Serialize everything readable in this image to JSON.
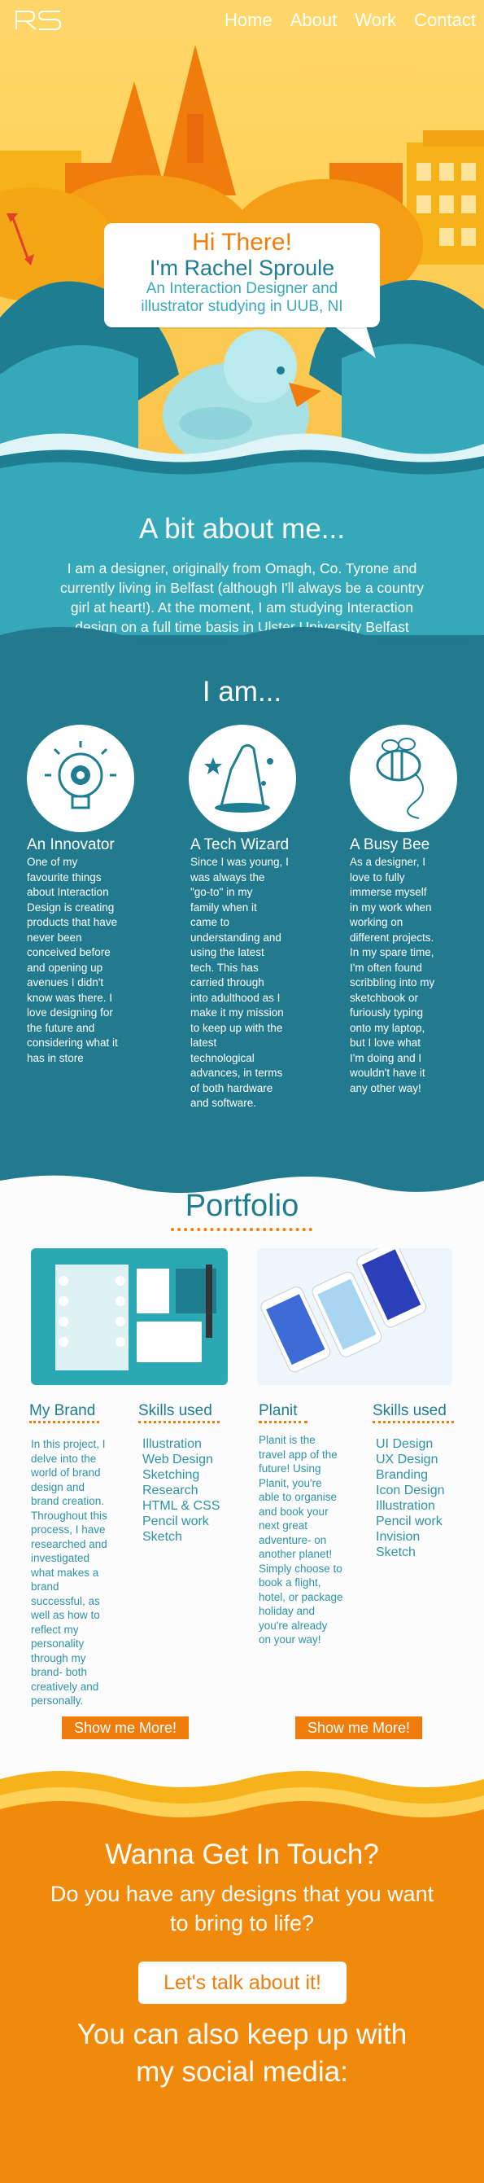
{
  "nav": {
    "logo": "RS",
    "links": [
      "Home",
      "About",
      "Work",
      "Contact"
    ]
  },
  "hero": {
    "greeting": "Hi There!",
    "name": "I'm Rachel Sproule",
    "subtitle_line1": "An Interaction Designer and",
    "subtitle_line2": "illustrator studying in UUB, NI"
  },
  "about": {
    "heading": "A bit about me...",
    "lines": [
      "I am a designer, originally from Omagh, Co. Tyrone and",
      "currently living in Belfast (although I'll always be a country",
      "girl at heart!). At the moment, I am studying Interaction",
      "design on a full time basis in Ulster University Belfast"
    ]
  },
  "iam": {
    "heading": "I am...",
    "columns": [
      {
        "icon": "lightbulb-gear-icon",
        "title": "An Innovator",
        "lines": [
          "One of my",
          "favourite  things",
          "about Interaction",
          "Design is creating",
          "products that have",
          "never been",
          "conceived before",
          "and opening up",
          "avenues I didn't",
          "know was there. I",
          "love designing for",
          "the future and",
          "considering what it",
          "has in store"
        ]
      },
      {
        "icon": "wizard-hat-icon",
        "title": "A Tech Wizard",
        "lines": [
          "Since I was young, I",
          "was always the",
          "\"go-to\" in my",
          "family when it",
          "came to",
          "understanding and",
          "using the latest",
          "tech. This has",
          "carried through",
          "into adulthood as I",
          "make it my mission",
          "to keep up with the",
          "latest",
          "technological",
          "advances, in terms",
          "of both hardware",
          "and software."
        ]
      },
      {
        "icon": "bee-icon",
        "title": "A Busy Bee",
        "lines": [
          "As a designer, I",
          "love to fully",
          "immerse myself",
          "in my work when",
          "working on",
          "different projects.",
          "In my spare time,",
          "I'm often found",
          "scribbling into my",
          "sketchbook or",
          "furiously typing",
          "onto my laptop,",
          "but I love what",
          "I'm doing and I",
          "wouldn't have it",
          "any other way!"
        ]
      }
    ]
  },
  "portfolio": {
    "heading": "Portfolio",
    "projects": [
      {
        "title": "My Brand",
        "skills_title": "Skills used",
        "lines": [
          "In this project, I",
          "delve into the",
          "world of brand",
          "design and",
          "brand creation.",
          "Throughout this",
          "process, I have",
          "researched and",
          "investigated",
          "what makes a",
          "brand",
          "successful, as",
          "well as how to",
          "reflect my",
          "personality",
          "through my",
          "brand- both",
          "creatively and",
          "personally."
        ],
        "skills": [
          "Illustration",
          "Web Design",
          "Sketching",
          "Research",
          "HTML & CSS",
          "Pencil work",
          "Sketch"
        ],
        "button": "Show me More!"
      },
      {
        "title": "Planit",
        "skills_title": "Skills used",
        "lines": [
          "Planit is the",
          "travel app of the",
          "future! Using",
          "Planit, you're",
          "able to organise",
          "and book your",
          "next great",
          "adventure- on",
          "another planet!",
          "Simply choose to",
          "book a flight,",
          "hotel, or package",
          "holiday and",
          "you're already",
          "on your way!"
        ],
        "skills": [
          "UI Design",
          "UX Design",
          "Branding",
          "Icon Design",
          "Illustration",
          "Pencil work",
          "Invision",
          "Sketch"
        ],
        "button": "Show me More!"
      }
    ]
  },
  "contact": {
    "heading": "Wanna Get In Touch?",
    "sub_line1": "Do you have any designs that you want",
    "sub_line2": "to bring to life?",
    "button": "Let's talk about it!",
    "social_line1": "You can also keep up with",
    "social_line2": "my social media:"
  },
  "colors": {
    "orange": "#f07c0c",
    "teal_dark": "#1f7d91",
    "teal": "#35a9b9",
    "yellow": "#ffd25a"
  }
}
